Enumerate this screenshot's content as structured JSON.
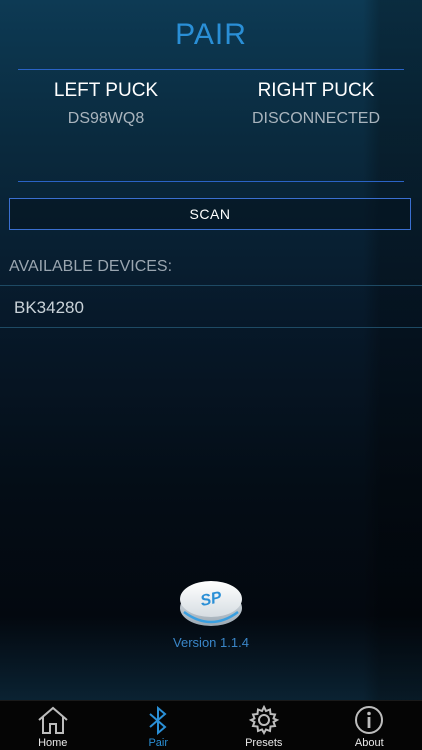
{
  "header": {
    "title": "PAIR"
  },
  "pucks": {
    "left": {
      "label": "LEFT PUCK",
      "status": "DS98WQ8"
    },
    "right": {
      "label": "RIGHT PUCK",
      "status": "DISCONNECTED"
    }
  },
  "scan_label": "SCAN",
  "available": {
    "heading": "AVAILABLE DEVICES:",
    "devices": [
      "BK34280"
    ]
  },
  "version": "Version 1.1.4",
  "logo": {
    "text": "SP"
  },
  "tabs": [
    {
      "label": "Home",
      "icon": "home-icon"
    },
    {
      "label": "Pair",
      "icon": "bluetooth-icon",
      "active": true
    },
    {
      "label": "Presets",
      "icon": "gear-icon"
    },
    {
      "label": "About",
      "icon": "info-icon"
    }
  ],
  "colors": {
    "accent": "#2a8fd6",
    "divider": "#2a63c6",
    "tabbar": "#050505"
  }
}
